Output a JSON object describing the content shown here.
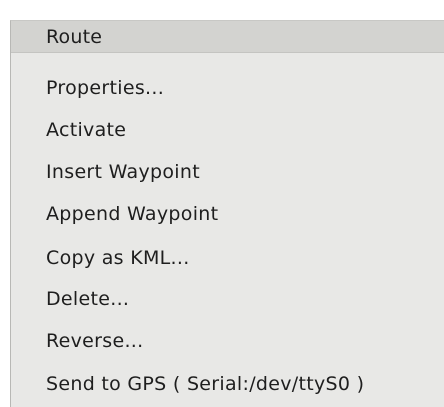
{
  "menu": {
    "title": "Route",
    "items": [
      {
        "label": "Properties..."
      },
      {
        "label": "Activate"
      },
      {
        "label": "Insert Waypoint"
      },
      {
        "label": "Append Waypoint"
      },
      {
        "label": "Copy as KML..."
      },
      {
        "label": "Delete..."
      },
      {
        "label": "Reverse..."
      },
      {
        "label": "Send to GPS ( Serial:/dev/ttyS0 )"
      }
    ]
  }
}
